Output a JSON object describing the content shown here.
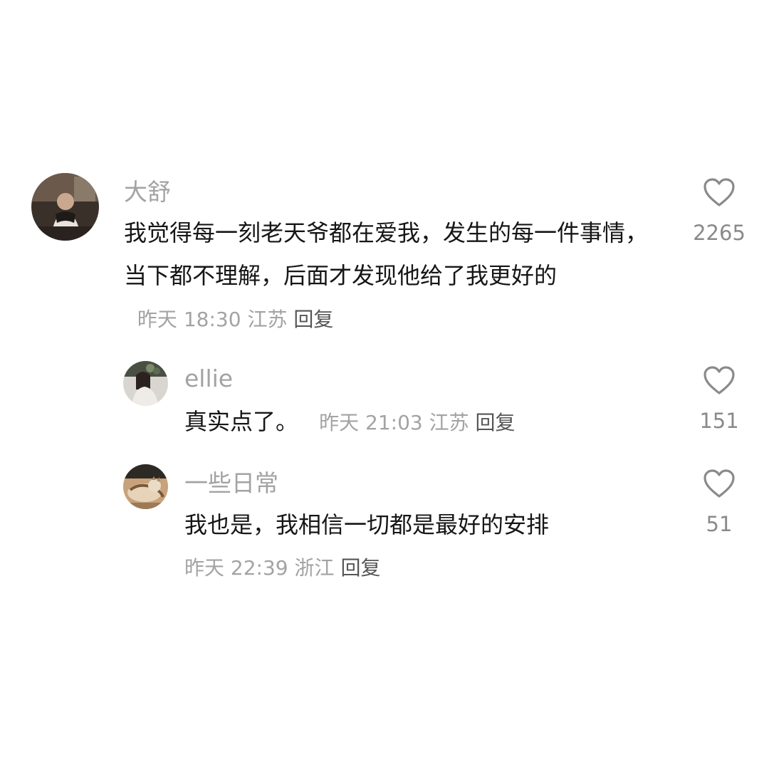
{
  "comments": [
    {
      "username": "大舒",
      "text": "我觉得每一刻老天爷都在爱我，发生的每一件事情，当下都不理解，后面才发现他给了我更好的",
      "date": "昨天",
      "time": "18:30",
      "location": "江苏",
      "reply_label": "回复",
      "like_count": "2265",
      "avatar_icon": "avatar-photo-person-dark",
      "like_icon": "heart-outline-icon"
    },
    {
      "username": "ellie",
      "text": "真实点了。",
      "date": "昨天",
      "time": "21:03",
      "location": "江苏",
      "reply_label": "回复",
      "like_count": "151",
      "avatar_icon": "avatar-photo-girl-flowers",
      "like_icon": "heart-outline-icon"
    },
    {
      "username": "一些日常",
      "text": "我也是，我相信一切都是最好的安排",
      "date": "昨天",
      "time": "22:39",
      "location": "浙江",
      "reply_label": "回复",
      "like_count": "51",
      "avatar_icon": "avatar-photo-cat",
      "like_icon": "heart-outline-icon"
    }
  ],
  "colors": {
    "text_primary": "#161616",
    "text_secondary": "#a3a3a3",
    "reply": "#555555",
    "icon_stroke": "#8a8a8a",
    "background": "#ffffff"
  }
}
